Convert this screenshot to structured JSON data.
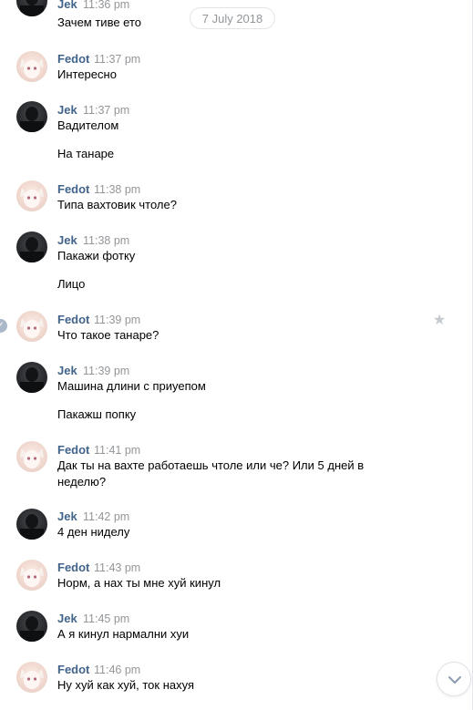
{
  "date_divider": "7 July 2018",
  "messages": [
    {
      "author": "Jek",
      "time": "11:36 pm",
      "lines": [
        "Зачем тиве ето"
      ]
    },
    {
      "author": "Fedot",
      "time": "11:37 pm",
      "lines": [
        "Интересно"
      ]
    },
    {
      "author": "Jek",
      "time": "11:37 pm",
      "lines": [
        "Вадителом",
        "На танаре"
      ]
    },
    {
      "author": "Fedot",
      "time": "11:38 pm",
      "lines": [
        "Типа вахтовик чтоле?"
      ]
    },
    {
      "author": "Jek",
      "time": "11:38 pm",
      "lines": [
        "Пакажи фотку",
        "Лицо"
      ]
    },
    {
      "author": "Fedot",
      "time": "11:39 pm",
      "lines": [
        "Что такое танаре?"
      ]
    },
    {
      "author": "Jek",
      "time": "11:39 pm",
      "lines": [
        "Машина длини с приуепом",
        "Пакажш попку"
      ]
    },
    {
      "author": "Fedot",
      "time": "11:41 pm",
      "lines": [
        "Дак ты на вахте работаешь чтоле или че? Или 5 дней в неделю?"
      ]
    },
    {
      "author": "Jek",
      "time": "11:42 pm",
      "lines": [
        "4 ден ниделу"
      ]
    },
    {
      "author": "Fedot",
      "time": "11:43 pm",
      "lines": [
        "Норм, а нах ты мне хуй кинул"
      ]
    },
    {
      "author": "Jek",
      "time": "11:45 pm",
      "lines": [
        "А я кинул нармални хуи"
      ]
    },
    {
      "author": "Fedot",
      "time": "11:46 pm",
      "lines": [
        "Ну хуй как хуй, ток нахуя"
      ]
    }
  ],
  "icons": {
    "selected_check": "check-icon",
    "favorite": "star-icon",
    "scroll_down": "chevron-down-icon"
  },
  "colors": {
    "author_name": "#42648b",
    "timestamp": "#939699",
    "star": "#c5cad1",
    "check_badge": "#aab8c9"
  }
}
